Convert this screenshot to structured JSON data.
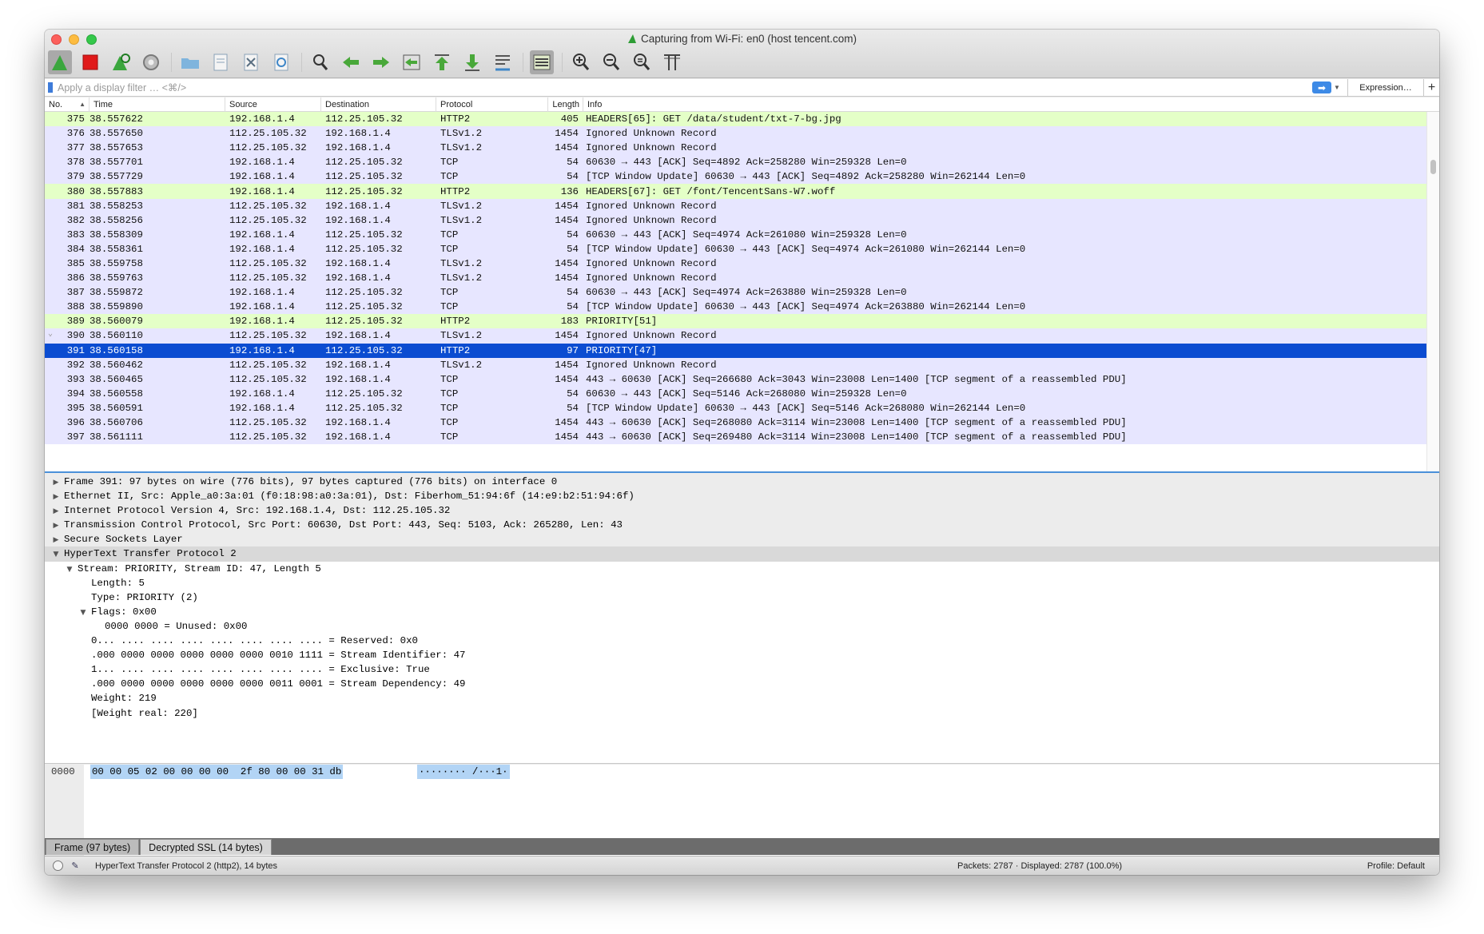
{
  "window": {
    "title": "Capturing from Wi-Fi: en0 (host tencent.com)"
  },
  "toolbar": {
    "buttons": [
      {
        "name": "start-capture-icon",
        "active": true
      },
      {
        "name": "stop-capture-icon"
      },
      {
        "name": "restart-capture-icon"
      },
      {
        "name": "capture-options-icon"
      },
      {
        "name": "open-file-icon"
      },
      {
        "name": "save-file-icon"
      },
      {
        "name": "close-file-icon"
      },
      {
        "name": "reload-file-icon"
      },
      {
        "name": "find-packet-icon"
      },
      {
        "name": "go-back-icon"
      },
      {
        "name": "go-forward-icon"
      },
      {
        "name": "go-to-packet-icon"
      },
      {
        "name": "go-first-icon"
      },
      {
        "name": "go-last-icon"
      },
      {
        "name": "autoscroll-icon"
      },
      {
        "name": "colorize-icon"
      },
      {
        "name": "zoom-in-icon"
      },
      {
        "name": "zoom-out-icon"
      },
      {
        "name": "normal-size-icon"
      },
      {
        "name": "resize-columns-icon"
      }
    ]
  },
  "filter": {
    "placeholder": "Apply a display filter … <⌘/>",
    "expression_label": "Expression…",
    "add_label": "+"
  },
  "packet_list": {
    "columns": [
      "No.",
      "Time",
      "Source",
      "Destination",
      "Protocol",
      "Length",
      "Info"
    ],
    "rows": [
      {
        "no": "375",
        "time": "38.557622",
        "src": "192.168.1.4",
        "dst": "112.25.105.32",
        "proto": "HTTP2",
        "len": "405",
        "info": "HEADERS[65]: GET /data/student/txt-7-bg.jpg",
        "kind": "http"
      },
      {
        "no": "376",
        "time": "38.557650",
        "src": "112.25.105.32",
        "dst": "192.168.1.4",
        "proto": "TLSv1.2",
        "len": "1454",
        "info": "Ignored Unknown Record",
        "kind": "tls"
      },
      {
        "no": "377",
        "time": "38.557653",
        "src": "112.25.105.32",
        "dst": "192.168.1.4",
        "proto": "TLSv1.2",
        "len": "1454",
        "info": "Ignored Unknown Record",
        "kind": "tls"
      },
      {
        "no": "378",
        "time": "38.557701",
        "src": "192.168.1.4",
        "dst": "112.25.105.32",
        "proto": "TCP",
        "len": "54",
        "info": "60630 → 443 [ACK] Seq=4892 Ack=258280 Win=259328 Len=0",
        "kind": "tcp"
      },
      {
        "no": "379",
        "time": "38.557729",
        "src": "192.168.1.4",
        "dst": "112.25.105.32",
        "proto": "TCP",
        "len": "54",
        "info": "[TCP Window Update] 60630 → 443 [ACK] Seq=4892 Ack=258280 Win=262144 Len=0",
        "kind": "tcp"
      },
      {
        "no": "380",
        "time": "38.557883",
        "src": "192.168.1.4",
        "dst": "112.25.105.32",
        "proto": "HTTP2",
        "len": "136",
        "info": "HEADERS[67]: GET /font/TencentSans-W7.woff",
        "kind": "http"
      },
      {
        "no": "381",
        "time": "38.558253",
        "src": "112.25.105.32",
        "dst": "192.168.1.4",
        "proto": "TLSv1.2",
        "len": "1454",
        "info": "Ignored Unknown Record",
        "kind": "tls"
      },
      {
        "no": "382",
        "time": "38.558256",
        "src": "112.25.105.32",
        "dst": "192.168.1.4",
        "proto": "TLSv1.2",
        "len": "1454",
        "info": "Ignored Unknown Record",
        "kind": "tls"
      },
      {
        "no": "383",
        "time": "38.558309",
        "src": "192.168.1.4",
        "dst": "112.25.105.32",
        "proto": "TCP",
        "len": "54",
        "info": "60630 → 443 [ACK] Seq=4974 Ack=261080 Win=259328 Len=0",
        "kind": "tcp"
      },
      {
        "no": "384",
        "time": "38.558361",
        "src": "192.168.1.4",
        "dst": "112.25.105.32",
        "proto": "TCP",
        "len": "54",
        "info": "[TCP Window Update] 60630 → 443 [ACK] Seq=4974 Ack=261080 Win=262144 Len=0",
        "kind": "tcp"
      },
      {
        "no": "385",
        "time": "38.559758",
        "src": "112.25.105.32",
        "dst": "192.168.1.4",
        "proto": "TLSv1.2",
        "len": "1454",
        "info": "Ignored Unknown Record",
        "kind": "tls"
      },
      {
        "no": "386",
        "time": "38.559763",
        "src": "112.25.105.32",
        "dst": "192.168.1.4",
        "proto": "TLSv1.2",
        "len": "1454",
        "info": "Ignored Unknown Record",
        "kind": "tls"
      },
      {
        "no": "387",
        "time": "38.559872",
        "src": "192.168.1.4",
        "dst": "112.25.105.32",
        "proto": "TCP",
        "len": "54",
        "info": "60630 → 443 [ACK] Seq=4974 Ack=263880 Win=259328 Len=0",
        "kind": "tcp"
      },
      {
        "no": "388",
        "time": "38.559890",
        "src": "192.168.1.4",
        "dst": "112.25.105.32",
        "proto": "TCP",
        "len": "54",
        "info": "[TCP Window Update] 60630 → 443 [ACK] Seq=4974 Ack=263880 Win=262144 Len=0",
        "kind": "tcp"
      },
      {
        "no": "389",
        "time": "38.560079",
        "src": "192.168.1.4",
        "dst": "112.25.105.32",
        "proto": "HTTP2",
        "len": "183",
        "info": "PRIORITY[51]",
        "kind": "http"
      },
      {
        "no": "390",
        "time": "38.560110",
        "src": "112.25.105.32",
        "dst": "192.168.1.4",
        "proto": "TLSv1.2",
        "len": "1454",
        "info": "Ignored Unknown Record",
        "kind": "tls",
        "tick": true
      },
      {
        "no": "391",
        "time": "38.560158",
        "src": "192.168.1.4",
        "dst": "112.25.105.32",
        "proto": "HTTP2",
        "len": "97",
        "info": "PRIORITY[47]",
        "kind": "sel"
      },
      {
        "no": "392",
        "time": "38.560462",
        "src": "112.25.105.32",
        "dst": "192.168.1.4",
        "proto": "TLSv1.2",
        "len": "1454",
        "info": "Ignored Unknown Record",
        "kind": "tls"
      },
      {
        "no": "393",
        "time": "38.560465",
        "src": "112.25.105.32",
        "dst": "192.168.1.4",
        "proto": "TCP",
        "len": "1454",
        "info": "443 → 60630 [ACK] Seq=266680 Ack=3043 Win=23008 Len=1400 [TCP segment of a reassembled PDU]",
        "kind": "tcp"
      },
      {
        "no": "394",
        "time": "38.560558",
        "src": "192.168.1.4",
        "dst": "112.25.105.32",
        "proto": "TCP",
        "len": "54",
        "info": "60630 → 443 [ACK] Seq=5146 Ack=268080 Win=259328 Len=0",
        "kind": "tcp"
      },
      {
        "no": "395",
        "time": "38.560591",
        "src": "192.168.1.4",
        "dst": "112.25.105.32",
        "proto": "TCP",
        "len": "54",
        "info": "[TCP Window Update] 60630 → 443 [ACK] Seq=5146 Ack=268080 Win=262144 Len=0",
        "kind": "tcp"
      },
      {
        "no": "396",
        "time": "38.560706",
        "src": "112.25.105.32",
        "dst": "192.168.1.4",
        "proto": "TCP",
        "len": "1454",
        "info": "443 → 60630 [ACK] Seq=268080 Ack=3114 Win=23008 Len=1400 [TCP segment of a reassembled PDU]",
        "kind": "tcp"
      },
      {
        "no": "397",
        "time": "38.561111",
        "src": "112.25.105.32",
        "dst": "192.168.1.4",
        "proto": "TCP",
        "len": "1454",
        "info": "443 → 60630 [ACK] Seq=269480 Ack=3114 Win=23008 Len=1400 [TCP segment of a reassembled PDU]",
        "kind": "tcp"
      }
    ]
  },
  "details": [
    {
      "indent": 0,
      "toggle": "closed",
      "text": "Frame 391: 97 bytes on wire (776 bits), 97 bytes captured (776 bits) on interface 0",
      "style": "top"
    },
    {
      "indent": 0,
      "toggle": "closed",
      "text": "Ethernet II, Src: Apple_a0:3a:01 (f0:18:98:a0:3a:01), Dst: Fiberhom_51:94:6f (14:e9:b2:51:94:6f)",
      "style": "top"
    },
    {
      "indent": 0,
      "toggle": "closed",
      "text": "Internet Protocol Version 4, Src: 192.168.1.4, Dst: 112.25.105.32",
      "style": "top"
    },
    {
      "indent": 0,
      "toggle": "closed",
      "text": "Transmission Control Protocol, Src Port: 60630, Dst Port: 443, Seq: 5103, Ack: 265280, Len: 43",
      "style": "top"
    },
    {
      "indent": 0,
      "toggle": "closed",
      "text": "Secure Sockets Layer",
      "style": "top"
    },
    {
      "indent": 0,
      "toggle": "open",
      "text": "HyperText Transfer Protocol 2",
      "style": "hl"
    },
    {
      "indent": 1,
      "toggle": "open",
      "text": "Stream: PRIORITY, Stream ID: 47, Length 5",
      "style": ""
    },
    {
      "indent": 2,
      "toggle": "none",
      "text": "Length: 5",
      "style": ""
    },
    {
      "indent": 2,
      "toggle": "none",
      "text": "Type: PRIORITY (2)",
      "style": ""
    },
    {
      "indent": 2,
      "toggle": "open",
      "text": "Flags: 0x00",
      "style": ""
    },
    {
      "indent": 3,
      "toggle": "none",
      "text": "0000 0000 = Unused: 0x00",
      "style": ""
    },
    {
      "indent": 2,
      "toggle": "none",
      "text": "0... .... .... .... .... .... .... .... = Reserved: 0x0",
      "style": ""
    },
    {
      "indent": 2,
      "toggle": "none",
      "text": ".000 0000 0000 0000 0000 0000 0010 1111 = Stream Identifier: 47",
      "style": ""
    },
    {
      "indent": 2,
      "toggle": "none",
      "text": "1... .... .... .... .... .... .... .... = Exclusive: True",
      "style": ""
    },
    {
      "indent": 2,
      "toggle": "none",
      "text": ".000 0000 0000 0000 0000 0000 0011 0001 = Stream Dependency: 49",
      "style": ""
    },
    {
      "indent": 2,
      "toggle": "none",
      "text": "Weight: 219",
      "style": ""
    },
    {
      "indent": 2,
      "toggle": "none",
      "text": "[Weight real: 220]",
      "style": ""
    }
  ],
  "bytes": {
    "offset": "0000",
    "hex": "00 00 05 02 00 00 00 00  2f 80 00 00 31 db",
    "ascii": "········ /···1·"
  },
  "byte_tabs": [
    "Frame (97 bytes)",
    "Decrypted SSL (14 bytes)"
  ],
  "status": {
    "left": "HyperText Transfer Protocol 2 (http2), 14 bytes",
    "packets": "Packets: 2787 · Displayed: 2787 (100.0%)",
    "profile": "Profile: Default"
  },
  "colors": {
    "http_row": "#e4ffc7",
    "tcp_row": "#e7e6ff",
    "selected_row": "#0b4cd1",
    "bytes_highlight": "#b2d4f5"
  }
}
